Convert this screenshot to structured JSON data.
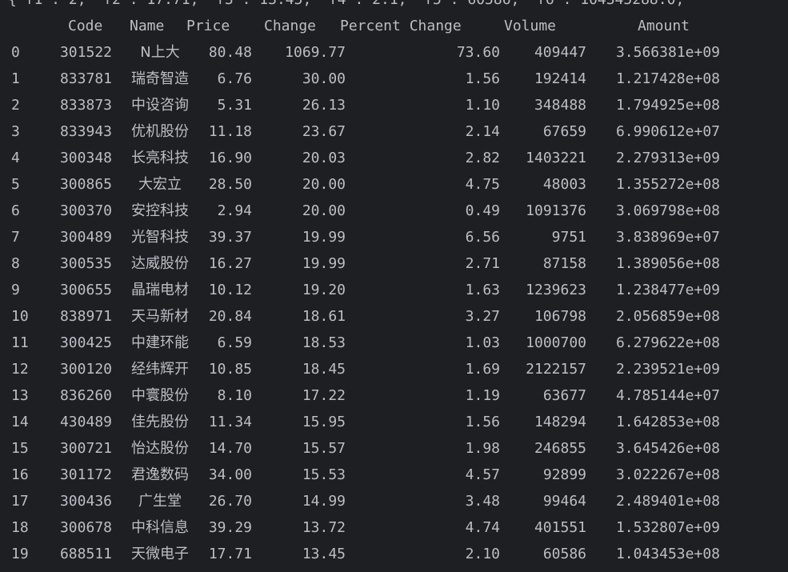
{
  "overflow_text": "{'f1': 2, 'f2': 17.71, 'f3': 13.45, 'f4': 2.1, 'f5': 60586, 'f6': 104345288.0, '",
  "headers": {
    "index": "",
    "code": "Code",
    "name": "Name",
    "price": "Price",
    "change": "Change",
    "percent": "Percent Change",
    "volume": "Volume",
    "amount": "Amount"
  },
  "rows": [
    {
      "idx": "0",
      "code": "301522",
      "name": "N上大",
      "price": "80.48",
      "change": "1069.77",
      "pct": "73.60",
      "vol": "409447",
      "amt": "3.566381e+09"
    },
    {
      "idx": "1",
      "code": "833781",
      "name": "瑞奇智造",
      "price": "6.76",
      "change": "30.00",
      "pct": "1.56",
      "vol": "192414",
      "amt": "1.217428e+08"
    },
    {
      "idx": "2",
      "code": "833873",
      "name": "中设咨询",
      "price": "5.31",
      "change": "26.13",
      "pct": "1.10",
      "vol": "348488",
      "amt": "1.794925e+08"
    },
    {
      "idx": "3",
      "code": "833943",
      "name": "优机股份",
      "price": "11.18",
      "change": "23.67",
      "pct": "2.14",
      "vol": "67659",
      "amt": "6.990612e+07"
    },
    {
      "idx": "4",
      "code": "300348",
      "name": "长亮科技",
      "price": "16.90",
      "change": "20.03",
      "pct": "2.82",
      "vol": "1403221",
      "amt": "2.279313e+09"
    },
    {
      "idx": "5",
      "code": "300865",
      "name": "大宏立",
      "price": "28.50",
      "change": "20.00",
      "pct": "4.75",
      "vol": "48003",
      "amt": "1.355272e+08"
    },
    {
      "idx": "6",
      "code": "300370",
      "name": "安控科技",
      "price": "2.94",
      "change": "20.00",
      "pct": "0.49",
      "vol": "1091376",
      "amt": "3.069798e+08"
    },
    {
      "idx": "7",
      "code": "300489",
      "name": "光智科技",
      "price": "39.37",
      "change": "19.99",
      "pct": "6.56",
      "vol": "9751",
      "amt": "3.838969e+07"
    },
    {
      "idx": "8",
      "code": "300535",
      "name": "达威股份",
      "price": "16.27",
      "change": "19.99",
      "pct": "2.71",
      "vol": "87158",
      "amt": "1.389056e+08"
    },
    {
      "idx": "9",
      "code": "300655",
      "name": "晶瑞电材",
      "price": "10.12",
      "change": "19.20",
      "pct": "1.63",
      "vol": "1239623",
      "amt": "1.238477e+09"
    },
    {
      "idx": "10",
      "code": "838971",
      "name": "天马新材",
      "price": "20.84",
      "change": "18.61",
      "pct": "3.27",
      "vol": "106798",
      "amt": "2.056859e+08"
    },
    {
      "idx": "11",
      "code": "300425",
      "name": "中建环能",
      "price": "6.59",
      "change": "18.53",
      "pct": "1.03",
      "vol": "1000700",
      "amt": "6.279622e+08"
    },
    {
      "idx": "12",
      "code": "300120",
      "name": "经纬辉开",
      "price": "10.85",
      "change": "18.45",
      "pct": "1.69",
      "vol": "2122157",
      "amt": "2.239521e+09"
    },
    {
      "idx": "13",
      "code": "836260",
      "name": "中寰股份",
      "price": "8.10",
      "change": "17.22",
      "pct": "1.19",
      "vol": "63677",
      "amt": "4.785144e+07"
    },
    {
      "idx": "14",
      "code": "430489",
      "name": "佳先股份",
      "price": "11.34",
      "change": "15.95",
      "pct": "1.56",
      "vol": "148294",
      "amt": "1.642853e+08"
    },
    {
      "idx": "15",
      "code": "300721",
      "name": "怡达股份",
      "price": "14.70",
      "change": "15.57",
      "pct": "1.98",
      "vol": "246855",
      "amt": "3.645426e+08"
    },
    {
      "idx": "16",
      "code": "301172",
      "name": "君逸数码",
      "price": "34.00",
      "change": "15.53",
      "pct": "4.57",
      "vol": "92899",
      "amt": "3.022267e+08"
    },
    {
      "idx": "17",
      "code": "300436",
      "name": "广生堂",
      "price": "26.70",
      "change": "14.99",
      "pct": "3.48",
      "vol": "99464",
      "amt": "2.489401e+08"
    },
    {
      "idx": "18",
      "code": "300678",
      "name": "中科信息",
      "price": "39.29",
      "change": "13.72",
      "pct": "4.74",
      "vol": "401551",
      "amt": "1.532807e+09"
    },
    {
      "idx": "19",
      "code": "688511",
      "name": "天微电子",
      "price": "17.71",
      "change": "13.45",
      "pct": "2.10",
      "vol": "60586",
      "amt": "1.043453e+08"
    }
  ]
}
